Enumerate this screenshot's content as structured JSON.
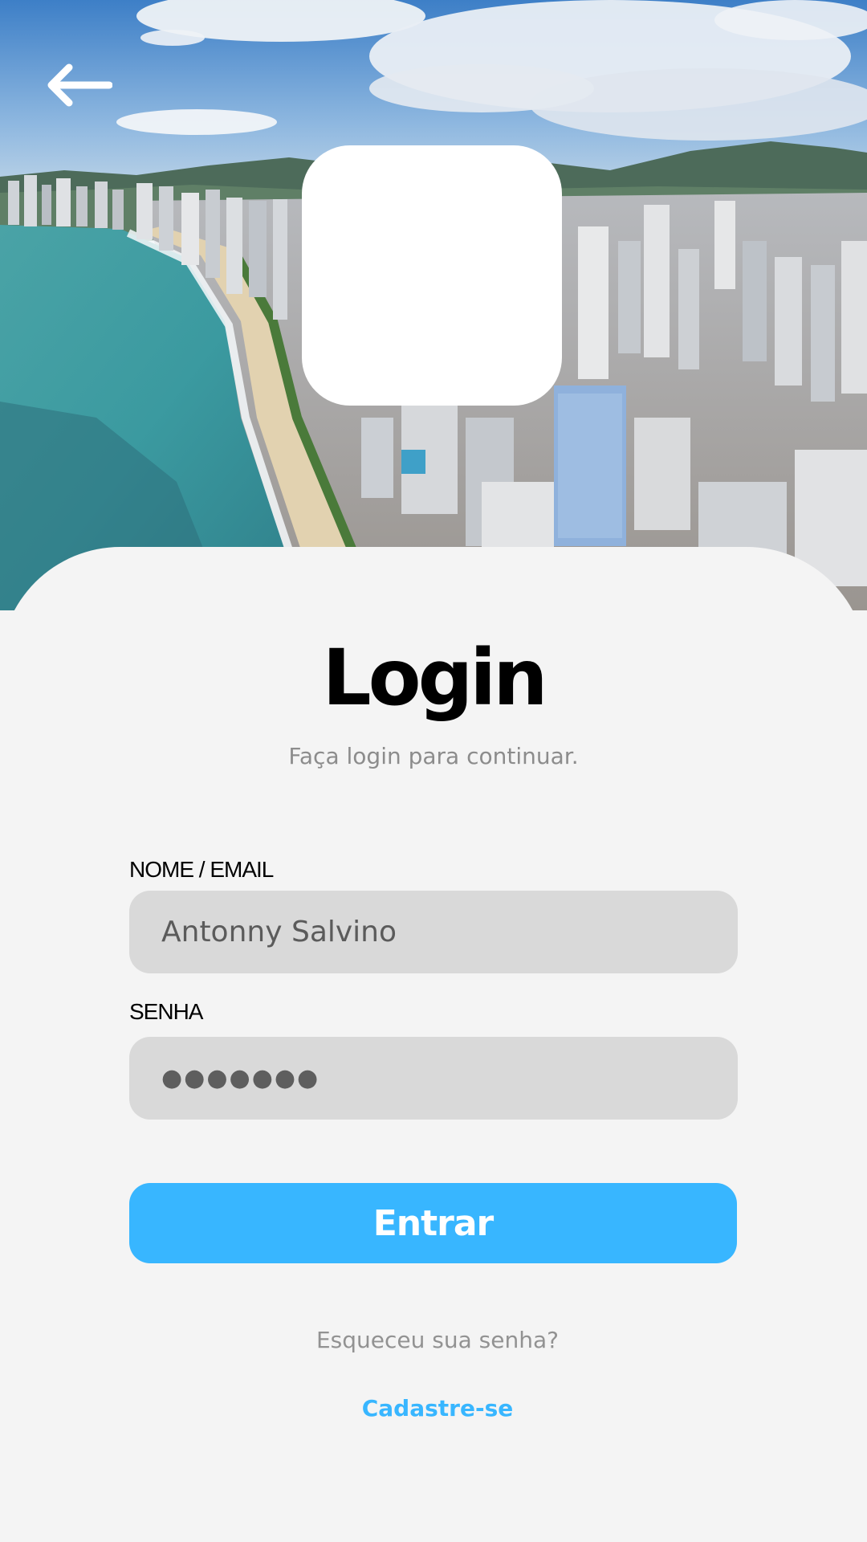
{
  "header": {
    "back_icon": "arrow-left-icon",
    "background": "aerial-beach-city-photo"
  },
  "login": {
    "title": "Login",
    "subtitle": "Faça login para continuar.",
    "email_label": "NOME / EMAIL",
    "email_value": "Antonny Salvino",
    "password_label": "SENHA",
    "password_value": "●●●●●●●",
    "submit_label": "Entrar",
    "forgot_label": "Esqueceu sua senha?",
    "signup_label": "Cadastre-se"
  },
  "colors": {
    "accent": "#38b6ff",
    "card_background": "#f4f4f4",
    "input_background": "#d9d9d9",
    "muted_text": "#8c8c8c"
  }
}
